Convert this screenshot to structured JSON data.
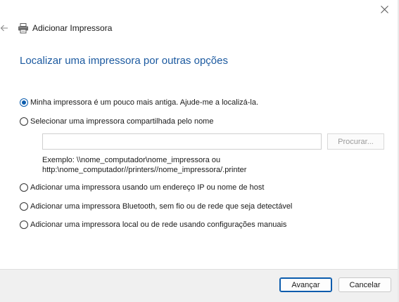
{
  "window": {
    "close_icon": "close-icon",
    "back_icon": "back-arrow-icon",
    "printer_icon": "printer-icon",
    "title": "Adicionar Impressora"
  },
  "heading": "Localizar uma impressora por outras opções",
  "options": [
    {
      "label": "Minha impressora é um pouco mais antiga. Ajude-me a localizá-la.",
      "checked": true
    },
    {
      "label": "Selecionar uma impressora compartilhada pelo nome",
      "checked": false
    },
    {
      "label": "Adicionar uma impressora usando um endereço IP ou nome de host",
      "checked": false
    },
    {
      "label": "Adicionar uma impressora Bluetooth, sem fio ou de rede que seja detectável",
      "checked": false
    },
    {
      "label": "Adicionar uma impressora local ou de rede usando configurações manuais",
      "checked": false
    }
  ],
  "shared_printer": {
    "input_value": "",
    "browse_label": "Procurar...",
    "example_line1": "Exemplo: \\\\nome_computador\\nome_impressora ou",
    "example_line2": "http:\\nome_computador//printers//nome_impressora/.printer"
  },
  "footer": {
    "next_label": "Avançar",
    "cancel_label": "Cancelar"
  },
  "colors": {
    "accent": "#0b5cad",
    "heading": "#1c5aa0",
    "footer_bg": "#f0f0f0"
  }
}
